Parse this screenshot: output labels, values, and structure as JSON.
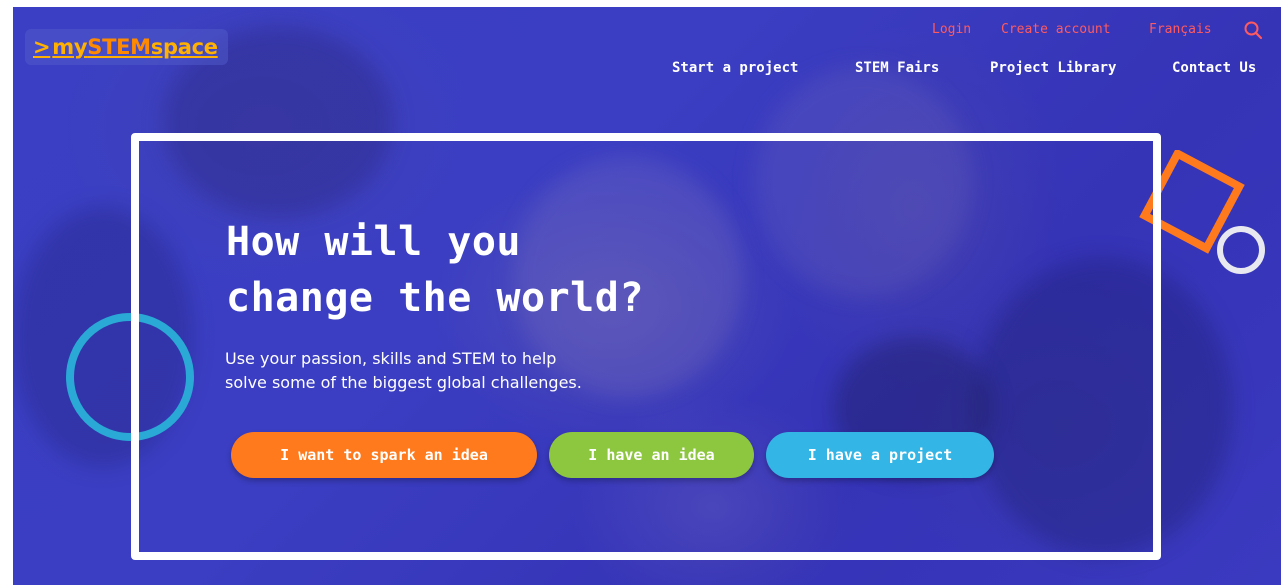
{
  "brand": {
    "logo_text": "mySTEMspace",
    "logo_prefix": ">my",
    "logo_stem": "STEM",
    "logo_suffix": "space",
    "colors": {
      "logo": "#ffb000",
      "accent_link": "#ff5a5f",
      "background": "#3a3dc2"
    }
  },
  "utility_nav": {
    "login": "Login",
    "create_account": "Create account",
    "language": "Français",
    "search_icon": "search-icon"
  },
  "main_nav": {
    "items": [
      "Start a project",
      "STEM Fairs",
      "Project Library",
      "Contact Us"
    ]
  },
  "hero": {
    "headline_line1": "How will you",
    "headline_line2": "change the world?",
    "subtext_line1": "Use your passion, skills and STEM to help",
    "subtext_line2": "solve some of the biggest global challenges.",
    "buttons": [
      {
        "label": "I want to spark an idea",
        "color": "#ff7a1c"
      },
      {
        "label": "I have an idea",
        "color": "#8dc63f"
      },
      {
        "label": "I have a project",
        "color": "#33b5e5"
      }
    ]
  },
  "decorations": {
    "circle_left_color": "#2aa8d6",
    "square_right_color": "#ff7a1c",
    "circle_right_color": "#e8e8f0"
  }
}
